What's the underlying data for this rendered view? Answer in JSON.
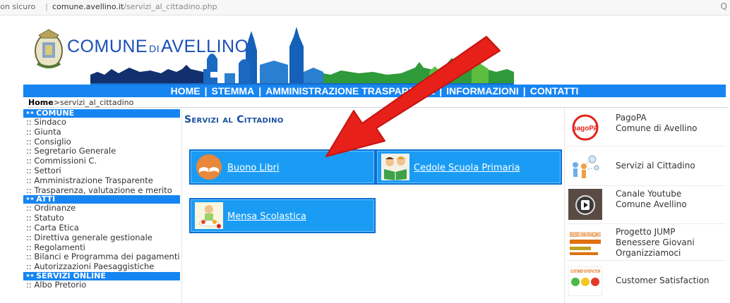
{
  "browser": {
    "security_label": "Non sicuro",
    "url_domain": "comune.avellino.it",
    "url_path": "/servizi_al_cittadino.php",
    "zoom_label": "Q"
  },
  "header": {
    "brand_prefix": "COMUNE",
    "brand_di": "DI",
    "brand_city": "AVELLINO",
    "crest_text": "Città di Avellino"
  },
  "topnav": {
    "items": [
      "HOME",
      "STEMMA",
      "AMMINISTRAZIONE TRASPARENTE",
      "INFORMAZIONI",
      "CONTATTI"
    ],
    "separator": "|"
  },
  "breadcrumb": {
    "home": "Home",
    "arrow": ">",
    "current": "servizi_al_cittadino"
  },
  "sidebar": {
    "sections": [
      {
        "title": "COMUNE",
        "items": [
          ":: Sindaco",
          ":: Giunta",
          ":: Consiglio",
          ":: Segretario Generale",
          ":: Commissioni C.",
          ":: Settori",
          ":: Amministrazione Trasparente",
          ":: Trasparenza, valutazione e merito"
        ]
      },
      {
        "title": "ATTI",
        "items": [
          ":: Ordinanze",
          ":: Statuto",
          ":: Carta Etica",
          ":: Direttiva generale gestionale",
          ":: Regolamenti",
          ":: Bilanci e Programma dei pagamenti",
          ":: Autorizzazioni Paesaggistiche"
        ]
      },
      {
        "title": "SERVIZI ONLINE",
        "items": [
          ":: Albo Pretorio"
        ]
      }
    ],
    "bullet": "••"
  },
  "main": {
    "title": "Servizi al Cittadino",
    "tiles": [
      "Buono Libri",
      "Cedole Scuola Primaria",
      "Mensa Scolastica"
    ]
  },
  "right": {
    "items": [
      {
        "lines": [
          "PagoPA",
          "Comune di Avellino"
        ],
        "thumb_label": "pagoPA"
      },
      {
        "lines": [
          "Servizi al Cittadino"
        ]
      },
      {
        "lines": [
          "Canale Youtube",
          "Comune Avellino"
        ]
      },
      {
        "lines": [
          "Progetto JUMP",
          "Benessere Giovani",
          "Organizziamoci"
        ],
        "thumb_label": "BENESSERE GIOVANI ORGANIZZIAMOCI"
      },
      {
        "lines": [
          "Customer Satisfaction"
        ],
        "thumb_label": "CUSTOMER SATISFACTION"
      }
    ]
  },
  "colors": {
    "nav_blue": "#1685f2",
    "tile_blue": "#1a9cf5",
    "title_blue": "#1a4fa0",
    "arrow_red": "#e8201a"
  }
}
